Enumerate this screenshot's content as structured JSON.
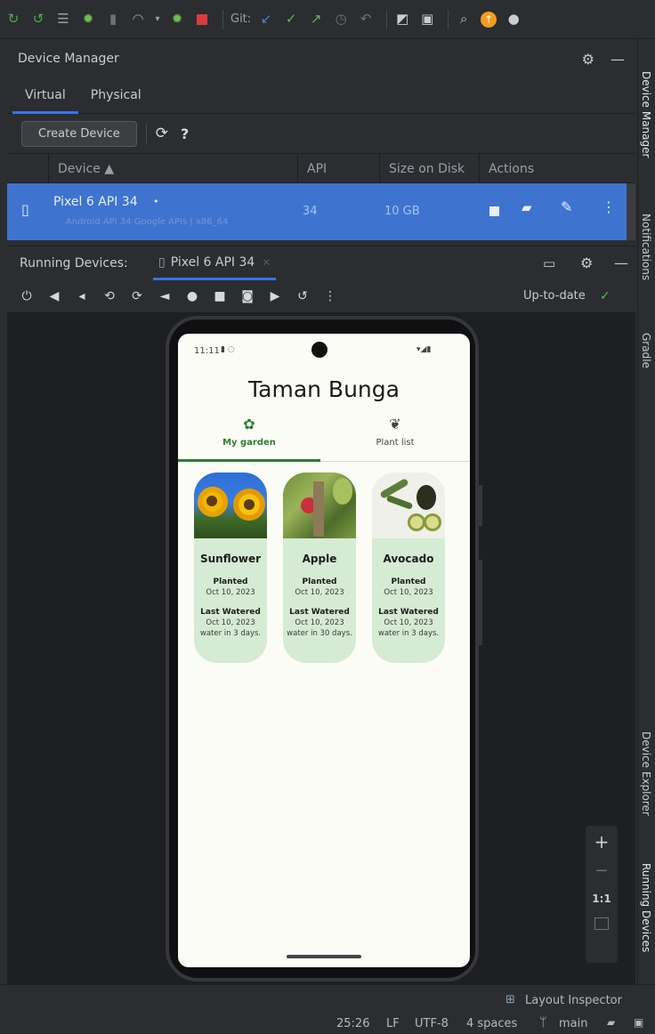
{
  "toolbar": {
    "git_label": "Git:"
  },
  "device_manager": {
    "title": "Device Manager",
    "tabs": [
      "Virtual",
      "Physical"
    ],
    "create_button": "Create Device",
    "help": "?",
    "columns": {
      "device": "Device ▲",
      "api": "API",
      "size": "Size on Disk",
      "actions": "Actions"
    },
    "device": {
      "name": "Pixel 6 API 34",
      "subtitle": "Android API 34 Google APIs | x86_64",
      "api": "34",
      "size": "10 GB"
    }
  },
  "running_devices": {
    "label": "Running Devices:",
    "tab": "Pixel 6 API 34",
    "status": "Up-to-date"
  },
  "phone": {
    "time": "11:11",
    "app_title": "Taman Bunga",
    "tabs": [
      "My garden",
      "Plant list"
    ],
    "plants": [
      {
        "name": "Sunflower",
        "planted_label": "Planted",
        "planted": "Oct 10, 2023",
        "watered_label": "Last Watered",
        "watered": "Oct 10, 2023",
        "note": "water in 3 days."
      },
      {
        "name": "Apple",
        "planted_label": "Planted",
        "planted": "Oct 10, 2023",
        "watered_label": "Last Watered",
        "watered": "Oct 10, 2023",
        "note": "water in 30 days."
      },
      {
        "name": "Avocado",
        "planted_label": "Planted",
        "planted": "Oct 10, 2023",
        "watered_label": "Last Watered",
        "watered": "Oct 10, 2023",
        "note": "water in 3 days."
      }
    ]
  },
  "side_panels": [
    "Device Manager",
    "Notifications",
    "Gradle",
    "Device Explorer",
    "Running Devices"
  ],
  "zoom": {
    "plus": "+",
    "minus": "−",
    "ratio": "1:1"
  },
  "status_bar": {
    "layout_inspector": "Layout Inspector",
    "position": "25:26",
    "line_ending": "LF",
    "encoding": "UTF-8",
    "indent": "4 spaces",
    "branch": "main"
  },
  "colors": {
    "accent": "#3574f0",
    "selected_row": "#3e74cf",
    "card": "#d6ebd3",
    "green": "#2e7d32"
  }
}
